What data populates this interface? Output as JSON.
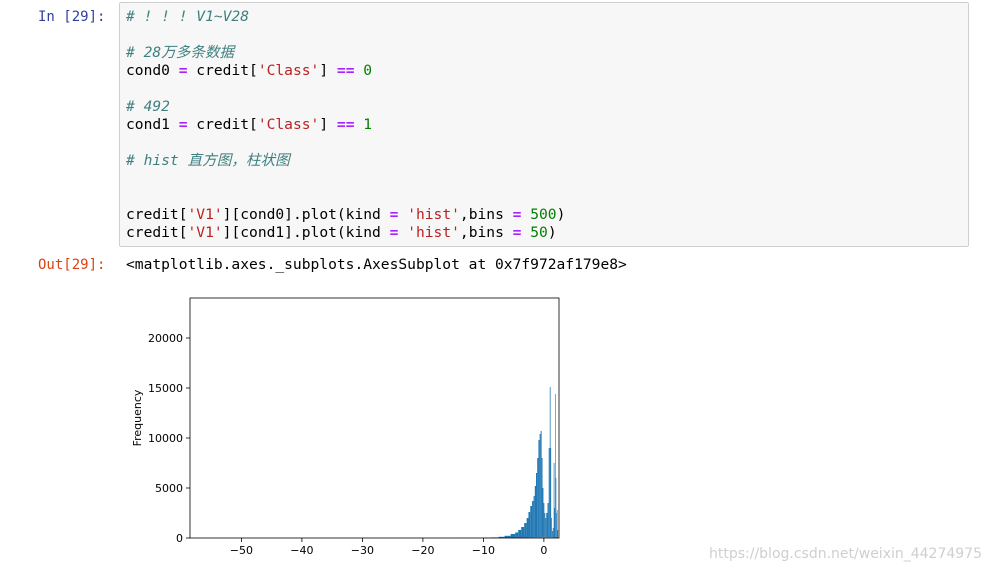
{
  "cell": {
    "in_prompt": "In [29]:",
    "out_prompt": "Out[29]:",
    "code_lines": [
      [
        {
          "t": "com",
          "v": "# ! ! ! V1~V28"
        }
      ],
      [],
      [
        {
          "t": "com",
          "v": "# 28万多条数据"
        }
      ],
      [
        {
          "t": "txt",
          "v": "cond0 "
        },
        {
          "t": "op",
          "v": "="
        },
        {
          "t": "txt",
          "v": " credit["
        },
        {
          "t": "str",
          "v": "'Class'"
        },
        {
          "t": "txt",
          "v": "] "
        },
        {
          "t": "op",
          "v": "=="
        },
        {
          "t": "txt",
          "v": " "
        },
        {
          "t": "num",
          "v": "0"
        }
      ],
      [],
      [
        {
          "t": "com",
          "v": "# 492"
        }
      ],
      [
        {
          "t": "txt",
          "v": "cond1 "
        },
        {
          "t": "op",
          "v": "="
        },
        {
          "t": "txt",
          "v": " credit["
        },
        {
          "t": "str",
          "v": "'Class'"
        },
        {
          "t": "txt",
          "v": "] "
        },
        {
          "t": "op",
          "v": "=="
        },
        {
          "t": "txt",
          "v": " "
        },
        {
          "t": "num",
          "v": "1"
        }
      ],
      [],
      [
        {
          "t": "com",
          "v": "# hist 直方图，柱状图"
        }
      ],
      [],
      [],
      [
        {
          "t": "txt",
          "v": "credit["
        },
        {
          "t": "str",
          "v": "'V1'"
        },
        {
          "t": "txt",
          "v": "][cond0].plot(kind "
        },
        {
          "t": "op",
          "v": "="
        },
        {
          "t": "txt",
          "v": " "
        },
        {
          "t": "str",
          "v": "'hist'"
        },
        {
          "t": "txt",
          "v": ",bins "
        },
        {
          "t": "op",
          "v": "="
        },
        {
          "t": "txt",
          "v": " "
        },
        {
          "t": "num",
          "v": "500"
        },
        {
          "t": "txt",
          "v": ")"
        }
      ],
      [
        {
          "t": "txt",
          "v": "credit["
        },
        {
          "t": "str",
          "v": "'V1'"
        },
        {
          "t": "txt",
          "v": "][cond1].plot(kind "
        },
        {
          "t": "op",
          "v": "="
        },
        {
          "t": "txt",
          "v": " "
        },
        {
          "t": "str",
          "v": "'hist'"
        },
        {
          "t": "txt",
          "v": ",bins "
        },
        {
          "t": "op",
          "v": "="
        },
        {
          "t": "txt",
          "v": " "
        },
        {
          "t": "num",
          "v": "50"
        },
        {
          "t": "txt",
          "v": ")"
        }
      ]
    ],
    "output_text": "<matplotlib.axes._subplots.AxesSubplot at 0x7f972af179e8>"
  },
  "chart_data": {
    "type": "bar",
    "ylabel": "Frequency",
    "xlim": [
      -58.5,
      2.5
    ],
    "ylim": [
      0,
      24000
    ],
    "xticks": [
      -50,
      -40,
      -30,
      -20,
      -10,
      0
    ],
    "xtick_labels": [
      "−50",
      "−40",
      "−30",
      "−20",
      "−10",
      "0"
    ],
    "yticks": [
      0,
      5000,
      10000,
      15000,
      20000
    ],
    "series": [
      {
        "color": "#1f77b4",
        "x": [
          -9.5,
          -8,
          -7,
          -6,
          -5,
          -4.5,
          -4,
          -3.5,
          -3,
          -2.7,
          -2.4,
          -2.1,
          -1.8,
          -1.6,
          -1.4,
          -1.2,
          -1.0,
          -0.8,
          -0.6,
          -0.45,
          -0.3,
          -0.15,
          0.0,
          0.15,
          0.3,
          0.5,
          0.7,
          0.9,
          1.05,
          1.15,
          1.25,
          1.4,
          1.55,
          1.7,
          1.8,
          1.9,
          2.0,
          2.1,
          2.2,
          2.3
        ],
        "values": [
          30,
          60,
          120,
          220,
          400,
          550,
          800,
          1100,
          1500,
          2000,
          2600,
          3200,
          3700,
          4200,
          5200,
          6500,
          8000,
          9800,
          10400,
          10700,
          8000,
          5000,
          3500,
          2500,
          2000,
          2500,
          3500,
          9000,
          15100,
          9000,
          2000,
          700,
          1000,
          7500,
          3000,
          14400,
          6000,
          2500,
          2800,
          800
        ]
      },
      {
        "color": "#ff7f0e",
        "x": [
          -20,
          -10,
          -6,
          -4,
          -3,
          -2,
          -1,
          0,
          1,
          2
        ],
        "values": [
          5,
          10,
          20,
          40,
          60,
          80,
          100,
          120,
          100,
          50
        ]
      }
    ],
    "watermark": "https://blog.csdn.net/weixin_44274975"
  }
}
